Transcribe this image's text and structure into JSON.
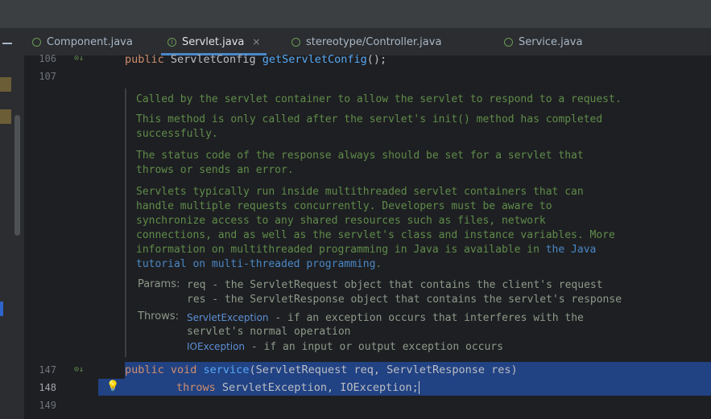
{
  "tabs": [
    {
      "label": "Component.java"
    },
    {
      "label": "Servlet.java",
      "close": "×"
    },
    {
      "label": "stereotype/Controller.java"
    },
    {
      "label": "Service.java"
    }
  ],
  "lines": {
    "l106": "106",
    "l107": "107",
    "l147": "147",
    "l148": "148",
    "l149": "149"
  },
  "code": {
    "top_kw": "public ",
    "top_type": "ServletConfig ",
    "top_fn": "getServletConfig",
    "top_end": "();",
    "sig_kw": "public void ",
    "sig_fn": "service",
    "sig_rest": "(ServletRequest req, ServletResponse res)",
    "throws_kw": "throws ",
    "throws_rest": "ServletException, IOException;"
  },
  "doc": {
    "p1": "Called by the servlet container to allow the servlet to respond to a request.",
    "p2a": "This method is only called after the servlet's init() method has completed",
    "p2b": "successfully.",
    "p3a": "The status code of the response always should be set for a servlet that",
    "p3b": "throws or sends an error.",
    "p4a": "Servlets typically run inside multithreaded servlet containers that can",
    "p4b": "handle multiple requests concurrently. Developers must be aware to",
    "p4c": "synchronize access to any shared resources such as files, network",
    "p4d": "connections, and as well as the servlet's class and instance variables. More",
    "p4e": "information on multithreaded programming in Java is available in ",
    "p4e_link": "the Java",
    "p4f_link": "tutorial on multi-threaded programming",
    "p4f_end": ".",
    "params_label": "Params:",
    "param1": "req - the ServletRequest object that contains the client's request",
    "param2": "res - the ServletResponse object that contains the servlet's response",
    "throws_label": "Throws:",
    "exc1": "ServletException",
    "exc1_desc": " - if an exception occurs that interferes with the",
    "exc1_desc2": "servlet's normal operation",
    "exc2": "IOException",
    "exc2_desc": " - if an input or output exception occurs"
  }
}
